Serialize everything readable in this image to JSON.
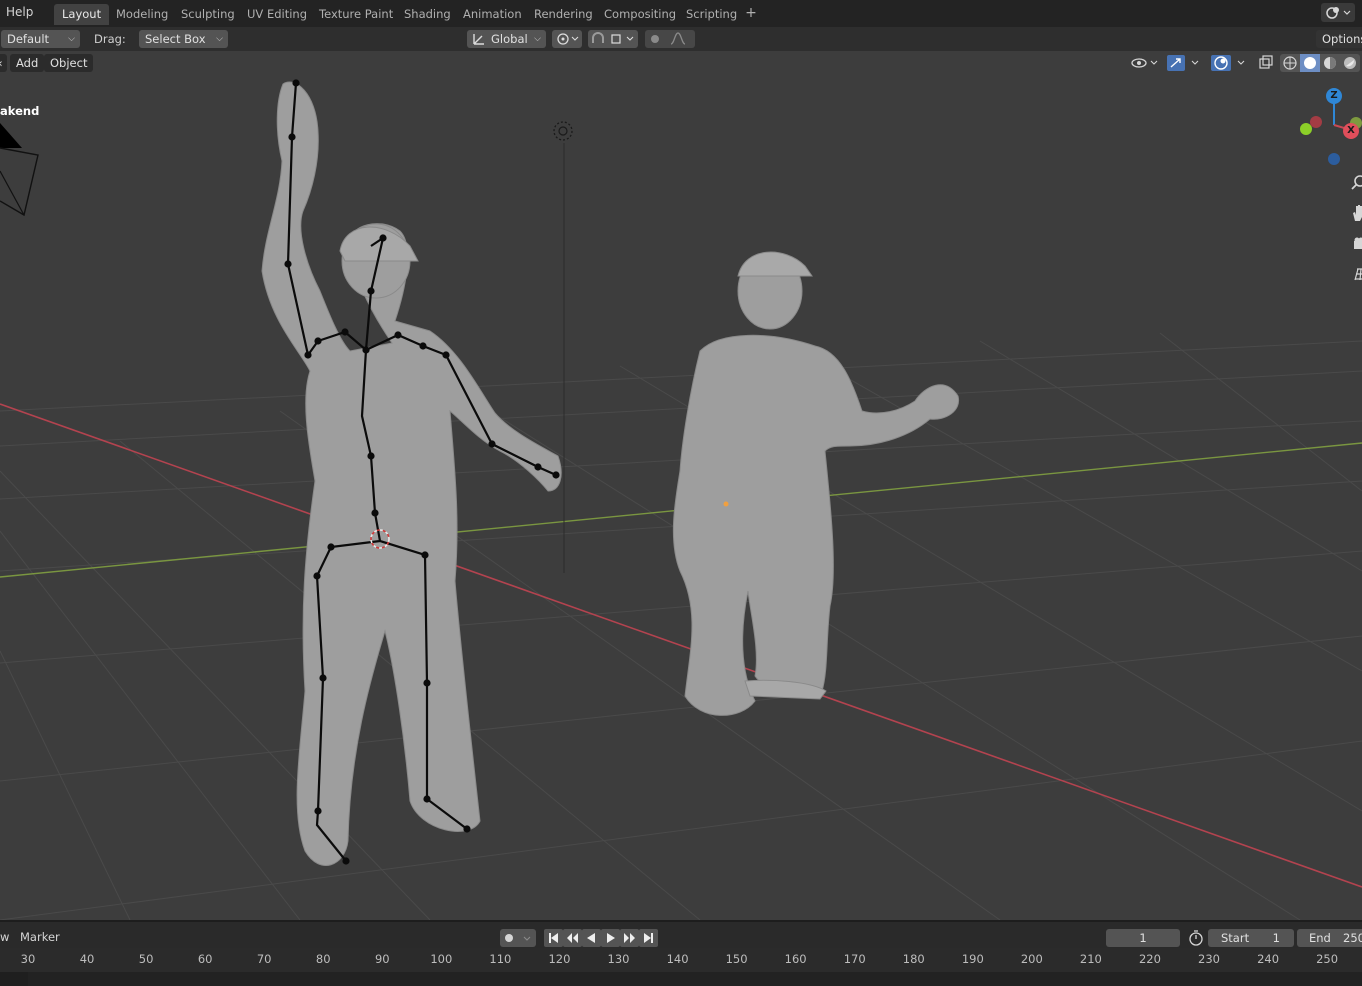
{
  "topbar": {
    "help_menu": "Help",
    "tabs": [
      {
        "label": "Layout",
        "active": true
      },
      {
        "label": "Modeling"
      },
      {
        "label": "Sculpting"
      },
      {
        "label": "UV Editing"
      },
      {
        "label": "Texture Paint"
      },
      {
        "label": "Shading"
      },
      {
        "label": "Animation"
      },
      {
        "label": "Rendering"
      },
      {
        "label": "Compositing"
      },
      {
        "label": "Scripting"
      }
    ],
    "add_tab": "+",
    "scene_icon": "scene-selector-icon"
  },
  "toolbar": {
    "orientation": "Default",
    "drag_label": "Drag:",
    "drag_value": "Select Box",
    "transform_orientation": "Global",
    "options": "Options"
  },
  "viewport": {
    "menu_add": "Add",
    "menu_object": "Object",
    "camera_label": "akend",
    "gizmo": {
      "z": "Z",
      "x": "X"
    },
    "colors": {
      "x_axis": "#c94a55",
      "y_axis": "#7e9a3f",
      "z_axis": "#2f87d6",
      "skeleton": "#0b0b0b",
      "figure": "#9e9e9e"
    }
  },
  "timeline": {
    "menu_view_fragment": "w",
    "menu_marker": "Marker",
    "current_frame": "1",
    "start_label": "Start",
    "start_value": "1",
    "end_label": "End",
    "end_value": "250",
    "ruler_ticks": [
      "30",
      "40",
      "50",
      "60",
      "70",
      "80",
      "90",
      "100",
      "110",
      "120",
      "130",
      "140",
      "150",
      "160",
      "170",
      "180",
      "190",
      "200",
      "210",
      "220",
      "230",
      "240",
      "250"
    ]
  }
}
